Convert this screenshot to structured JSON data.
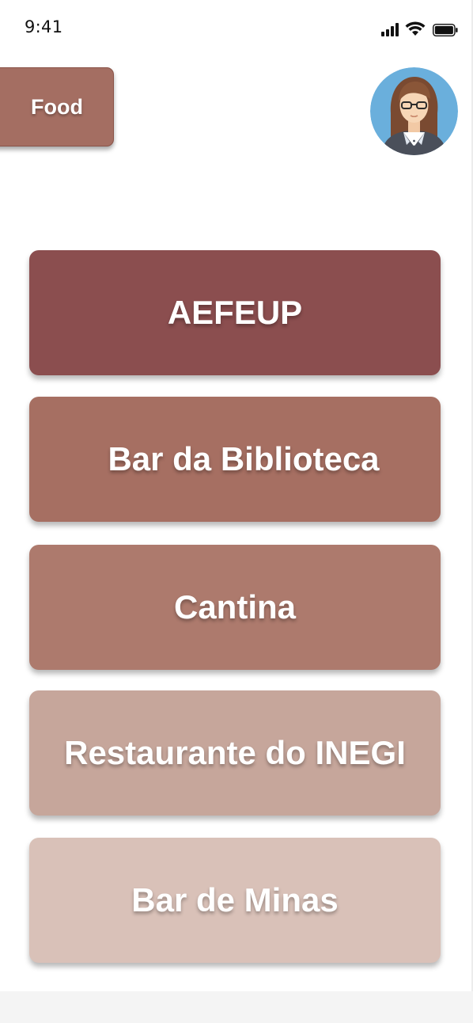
{
  "status_bar": {
    "time": "9:41"
  },
  "header": {
    "tab_label": "Food"
  },
  "places": [
    {
      "label": "AEFEUP",
      "color": "#8b4e4f"
    },
    {
      "label": "Bar da Biblioteca",
      "color": "#a66f62"
    },
    {
      "label": "Cantina",
      "color": "#ad7a6d"
    },
    {
      "label": "Restaurante do INEGI",
      "color": "#c6a69b"
    },
    {
      "label": "Bar de Minas",
      "color": "#d9c1b8"
    }
  ],
  "colors": {
    "tab_background": "#a46e62",
    "avatar_background": "#6aafdc",
    "text": "#ffffff"
  }
}
